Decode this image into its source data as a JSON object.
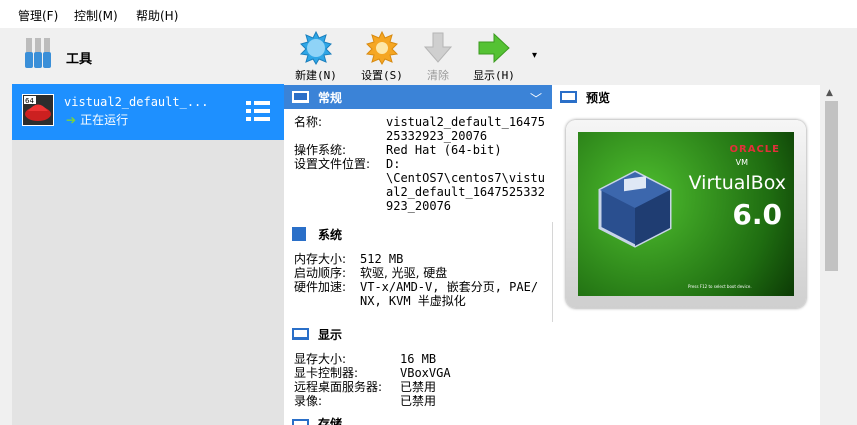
{
  "menu": [
    "管理(F)",
    "控制(M)",
    "帮助(H)"
  ],
  "tools": {
    "label": "工具"
  },
  "vm": {
    "name": "vistual2_default_...",
    "status": "正在运行",
    "os_badge": "64"
  },
  "toolbar": {
    "new": "新建(N)",
    "settings": "设置(S)",
    "discard": "清除",
    "show": "显示(H)",
    "dropdown": "▾"
  },
  "general": {
    "title": "常规",
    "rows": [
      {
        "k": "名称:",
        "v": [
          "vistual2_default_16475",
          "25332923_20076"
        ]
      },
      {
        "k": "操作系统:",
        "v": [
          "Red Hat (64-bit)"
        ]
      },
      {
        "k": "设置文件位置:",
        "v": [
          "D:",
          "\\CentOS7\\centos7\\vistu",
          "al2_default_1647525332",
          "923_20076"
        ]
      }
    ]
  },
  "system": {
    "title": "系统",
    "rows": [
      {
        "k": "内存大小:",
        "v": [
          "512 MB"
        ]
      },
      {
        "k": "启动顺序:",
        "v": [
          "软驱, 光驱, 硬盘"
        ]
      },
      {
        "k": "硬件加速:",
        "v": [
          "VT-x/AMD-V, 嵌套分页, PAE/",
          "NX, KVM 半虚拟化"
        ]
      }
    ]
  },
  "display": {
    "title": "显示",
    "rows": [
      {
        "k": "显存大小:",
        "v": [
          "16 MB"
        ]
      },
      {
        "k": "显卡控制器:",
        "v": [
          "VBoxVGA"
        ]
      },
      {
        "k": "远程桌面服务器:",
        "v": [
          "已禁用"
        ]
      },
      {
        "k": "录像:",
        "v": [
          "已禁用"
        ]
      }
    ]
  },
  "next_section": {
    "title": "存储"
  },
  "preview": {
    "title": "预览",
    "oracle": "ORACLE",
    "vm_label": "VM",
    "product": "VirtualBox",
    "version": "6.0",
    "hint": "Press F12 to select boot device."
  },
  "colors": {
    "selection": "#1e90ff",
    "header_blue": "#3b83d7",
    "running": "#7dd33a"
  }
}
